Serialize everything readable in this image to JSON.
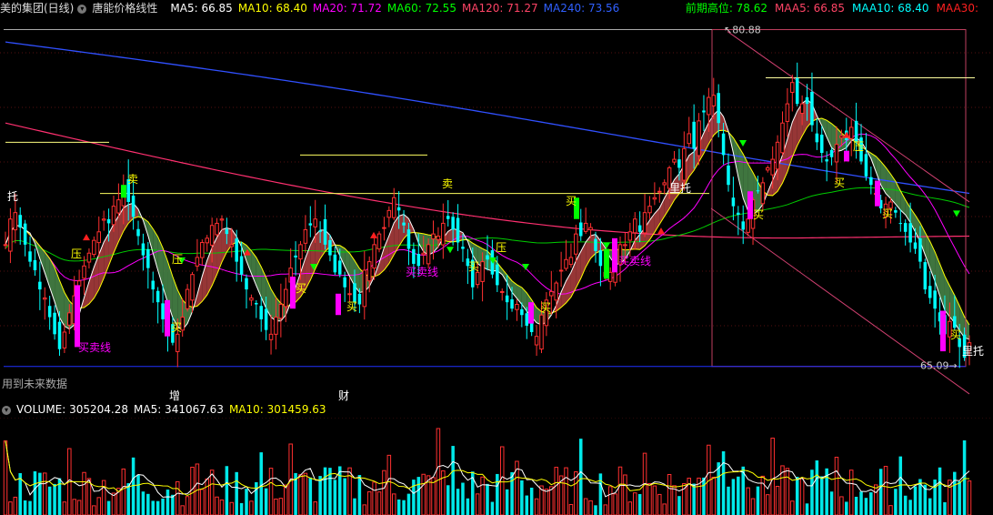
{
  "header": {
    "title": "美的集团(日线)",
    "indicator": "唐能价格线性",
    "ma": [
      {
        "label": "MA5: 66.85",
        "color": "#ffffff"
      },
      {
        "label": "MA10: 68.40",
        "color": "#ffff00"
      },
      {
        "label": "MA20: 71.72",
        "color": "#ff00ff"
      },
      {
        "label": "MA60: 72.55",
        "color": "#00ff00"
      },
      {
        "label": "MA120: 71.27",
        "color": "#ff4466"
      },
      {
        "label": "MA240: 73.56",
        "color": "#3060ff"
      }
    ],
    "right": [
      {
        "label": "前期高位: 78.62",
        "color": "#00ff00"
      },
      {
        "label": "MAA5: 66.85",
        "color": "#ff4466"
      },
      {
        "label": "MAA10: 68.40",
        "color": "#00ffff"
      },
      {
        "label": "MAA30:",
        "color": "#ff2020"
      }
    ]
  },
  "volume_header": {
    "label": "VOLUME: 305204.28",
    "ma5": "MA5: 341067.63",
    "ma10": "MA10: 301459.63"
  },
  "notes": {
    "future": "用到未来数据",
    "zeng": "增",
    "cai": "财",
    "high": "80.88",
    "low": "65.09",
    "litu": "里托"
  },
  "colors": {
    "up": "#ff3030",
    "down": "#00ffff",
    "ma240": "#3050ff",
    "ma120": "#ff3070",
    "ma60": "#00cc00",
    "ma10": "#ffff00",
    "ma20": "#ff00ff",
    "ma5": "#ffffff"
  },
  "annotations": [
    {
      "text": "卖",
      "color": "#ffff00"
    },
    {
      "text": "卖",
      "color": "#ffff00"
    },
    {
      "text": "里托",
      "color": "#ffffff"
    },
    {
      "text": "买",
      "color": "#ffff00"
    },
    {
      "text": "买",
      "color": "#ffff00"
    },
    {
      "text": "买",
      "color": "#ffff00"
    },
    {
      "text": "买",
      "color": "#ffff00"
    },
    {
      "text": "买",
      "color": "#ffff00"
    },
    {
      "text": "买",
      "color": "#ffff00"
    },
    {
      "text": "买",
      "color": "#ffff00"
    },
    {
      "text": "买",
      "color": "#ffff00"
    },
    {
      "text": "买",
      "color": "#ffff00"
    },
    {
      "text": "买",
      "color": "#ffff00"
    },
    {
      "text": "托",
      "color": "#ffffff"
    },
    {
      "text": "压",
      "color": "#ffff00"
    },
    {
      "text": "压",
      "color": "#ffff00"
    },
    {
      "text": "压",
      "color": "#ffff00"
    },
    {
      "text": "压",
      "color": "#ffff00"
    },
    {
      "text": "买卖线",
      "color": "#ff00ff"
    },
    {
      "text": "买卖线",
      "color": "#ff00ff"
    },
    {
      "text": "买卖线",
      "color": "#ff00ff"
    },
    {
      "text": "里托",
      "color": "#ffffff"
    }
  ],
  "chart_data": {
    "type": "candlestick",
    "title": "美的集团(日线)",
    "ylim": [
      63.5,
      81.5
    ],
    "labeled_high": 80.88,
    "labeled_low": 65.09,
    "resistance_level": 78.62,
    "ma_last": {
      "MA5": 66.85,
      "MA10": 68.4,
      "MA20": 71.72,
      "MA60": 72.55,
      "MA120": 71.27,
      "MA240": 73.56
    },
    "candles_close": [
      70.8,
      72.0,
      72.3,
      71.6,
      70.8,
      70.0,
      69.6,
      68.7,
      68.3,
      67.4,
      66.6,
      65.9,
      66.7,
      67.6,
      68.4,
      69.1,
      69.8,
      70.4,
      71.0,
      71.4,
      72.0,
      71.8,
      72.6,
      72.9,
      73.3,
      72.8,
      72.1,
      71.2,
      70.3,
      69.7,
      68.7,
      68.1,
      67.3,
      66.6,
      66.2,
      66.6,
      67.4,
      68.7,
      69.4,
      70.2,
      70.9,
      71.1,
      71.7,
      71.8,
      72.0,
      71.3,
      70.8,
      70.0,
      69.4,
      68.7,
      68.3,
      68.0,
      67.3,
      66.8,
      66.6,
      67.4,
      68.0,
      68.7,
      69.7,
      70.2,
      70.8,
      71.5,
      71.7,
      72.0,
      71.4,
      70.8,
      70.3,
      69.5,
      69.4,
      68.8,
      68.5,
      68.1,
      68.0,
      69.6,
      70.0,
      70.8,
      71.3,
      71.6,
      72.4,
      73.0,
      72.4,
      71.7,
      70.6,
      69.9,
      69.8,
      70.4,
      70.8,
      71.3,
      71.2,
      71.8,
      72.0,
      71.5,
      70.9,
      70.6,
      69.8,
      68.8,
      69.5,
      70.0,
      70.1,
      69.4,
      68.9,
      68.6,
      68.1,
      67.8,
      68.0,
      67.5,
      67.0,
      66.7,
      66.5,
      67.5,
      68.2,
      68.6,
      69.0,
      69.6,
      70.1,
      70.2,
      71.3,
      71.2,
      71.8,
      71.6,
      70.5,
      69.8,
      69.5,
      69.5,
      70.0,
      70.8,
      70.8,
      71.4,
      72.0,
      71.4,
      72.3,
      72.6,
      73.0,
      73.3,
      73.7,
      74.4,
      74.8,
      74.4,
      75.3,
      76.0,
      75.3,
      76.6,
      77.0,
      77.7,
      77.8,
      76.5,
      75.0,
      73.6,
      72.6,
      72.2,
      71.5,
      72.0,
      72.9,
      73.3,
      73.7,
      74.4,
      74.8,
      75.6,
      76.5,
      77.4,
      78.4,
      77.4,
      77.4,
      77.4,
      76.4,
      75.6,
      75.1,
      74.7,
      74.9,
      75.5,
      75.9,
      75.7,
      76.3,
      75.6,
      74.7,
      74.0,
      73.6,
      73.2,
      72.5,
      72.7,
      72.8,
      72.3,
      71.8,
      71.4,
      70.9,
      70.6,
      70.0,
      68.7,
      68.3,
      67.8,
      67.2,
      66.6,
      67.2,
      66.9,
      66.0,
      65.5,
      66.2
    ]
  }
}
